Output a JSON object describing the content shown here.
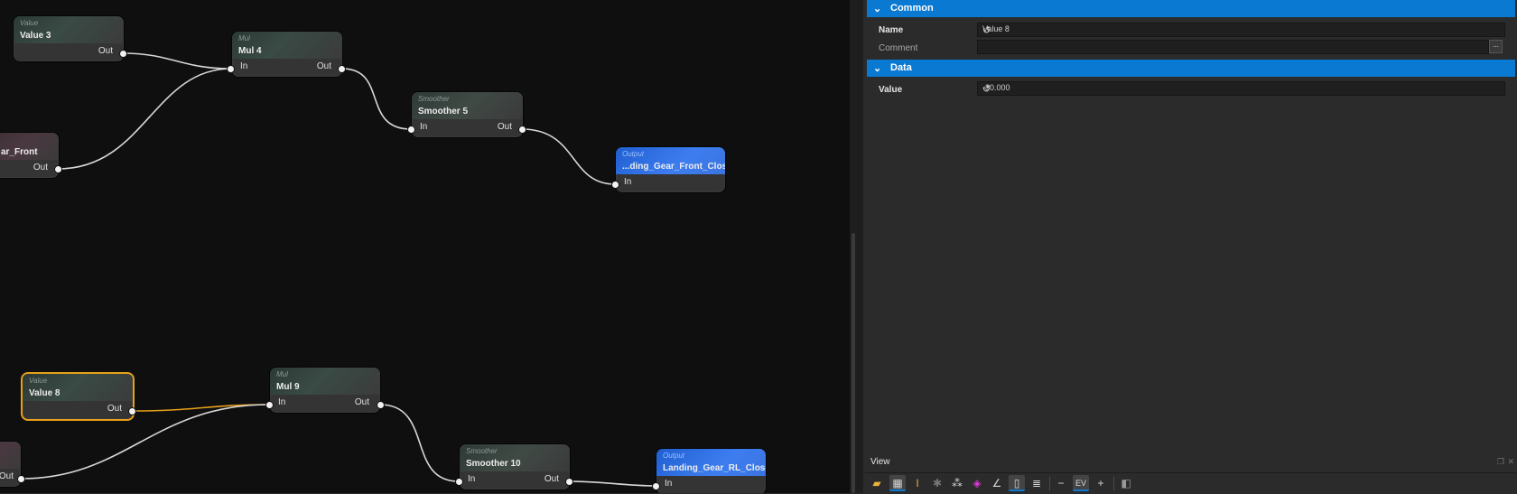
{
  "graph": {
    "nodes": [
      {
        "id": "value3",
        "type": "Value",
        "title": "Value 3",
        "out": "Out"
      },
      {
        "id": "mul4",
        "type": "Mul",
        "title": "Mul 4",
        "in": "In",
        "out": "Out"
      },
      {
        "id": "smoother5",
        "type": "Smoother",
        "title": "Smoother 5",
        "in": "In",
        "out": "Out"
      },
      {
        "id": "output_front",
        "type": "Output",
        "title": "...ding_Gear_Front_Close",
        "in": "In"
      },
      {
        "id": "gear_front",
        "title": "ar_Front",
        "out": "Out"
      },
      {
        "id": "value8",
        "type": "Value",
        "title": "Value 8",
        "out": "Out"
      },
      {
        "id": "mul9",
        "type": "Mul",
        "title": "Mul 9",
        "in": "In",
        "out": "Out"
      },
      {
        "id": "smoother10",
        "type": "Smoother",
        "title": "Smoother 10",
        "in": "In",
        "out": "Out"
      },
      {
        "id": "output_rl",
        "type": "Output",
        "title": "Landing_Gear_RL_Close",
        "in": "In"
      },
      {
        "id": "partial_bottom",
        "out": "Out"
      }
    ],
    "wire_color": "#d8d8d8",
    "selected_wire_color": "#e8a01a",
    "output_header_color": "#3d7df0"
  },
  "properties": {
    "common": {
      "title": "Common",
      "chevron": "❯"
    },
    "name": {
      "label": "Name",
      "value": "Value 8"
    },
    "comment": {
      "label": "Comment",
      "value": "",
      "button": "..."
    },
    "data": {
      "title": "Data",
      "chevron": "❯"
    },
    "value": {
      "label": "Value",
      "value": "-80.000"
    },
    "accent": "#0a79d2"
  },
  "view": {
    "title": "View",
    "toolbar": [
      {
        "icon": "folder-icon"
      },
      {
        "icon": "grid-icon",
        "on": true
      },
      {
        "icon": "cursor-text-icon",
        "on": false
      },
      {
        "icon": "skeleton-icon"
      },
      {
        "icon": "nodes-icon"
      },
      {
        "icon": "cube-icon"
      },
      {
        "icon": "angle-icon"
      },
      {
        "icon": "mouse-icon",
        "on": true
      },
      {
        "icon": "list-icon"
      },
      {
        "icon": "zoom-out-icon"
      },
      {
        "icon": "ev-icon",
        "label": "EV"
      },
      {
        "icon": "zoom-in-icon"
      },
      {
        "icon": "camera-icon"
      }
    ]
  }
}
